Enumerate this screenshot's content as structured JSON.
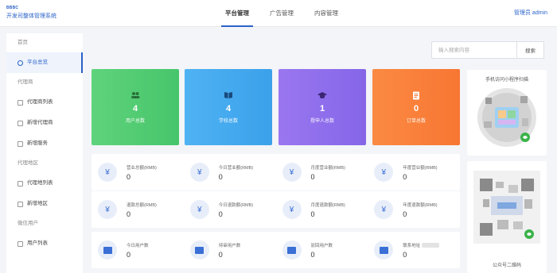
{
  "header": {
    "logo_mark": "BBBC",
    "logo_text": "开发司整体管理系统",
    "nav": [
      {
        "label": "平台管理",
        "active": true
      },
      {
        "label": "广告管理",
        "active": false
      },
      {
        "label": "内容管理",
        "active": false
      }
    ],
    "user": "管理员 admin"
  },
  "sidebar": {
    "items": [
      {
        "type": "group",
        "label": "首页"
      },
      {
        "type": "item",
        "label": "平台总览",
        "active": true
      },
      {
        "type": "group",
        "label": "代理商"
      },
      {
        "type": "item",
        "label": "代理商列表"
      },
      {
        "type": "item",
        "label": "新增代理商"
      },
      {
        "type": "item",
        "label": "新增服务"
      },
      {
        "type": "group",
        "label": "代理地区"
      },
      {
        "type": "item",
        "label": "代理地列表"
      },
      {
        "type": "item",
        "label": "新增地区"
      },
      {
        "type": "group",
        "label": "微信用户"
      },
      {
        "type": "item",
        "label": "用户列表"
      }
    ]
  },
  "search": {
    "placeholder": "输入搜索内容",
    "button": "搜索"
  },
  "cards": [
    {
      "icon": "users-icon",
      "glyph": "👥",
      "value": "4",
      "label": "用户总数",
      "color": "#4fcb72"
    },
    {
      "icon": "book-icon",
      "glyph": "📖",
      "value": "4",
      "label": "学校总数",
      "color": "#42a8ee"
    },
    {
      "icon": "graduation-cap-icon",
      "glyph": "🎓",
      "value": "1",
      "label": "授申人总数",
      "color": "#8e6eec"
    },
    {
      "icon": "document-icon",
      "glyph": "📄",
      "value": "0",
      "label": "订单总数",
      "color": "#f8803a"
    }
  ],
  "stats_row1": [
    {
      "label": "营业总额(RMB)",
      "value": "0"
    },
    {
      "label": "今日营业额(RMB)",
      "value": "0"
    },
    {
      "label": "月度营业额(RMB)",
      "value": "0"
    },
    {
      "label": "年度营业额(RMB)",
      "value": "0"
    }
  ],
  "stats_row2": [
    {
      "label": "退款总额(RMB)",
      "value": "0"
    },
    {
      "label": "今日退款额(RMB)",
      "value": "0"
    },
    {
      "label": "月度退款额(RMB)",
      "value": "0"
    },
    {
      "label": "年度退款额(RMB)",
      "value": "0"
    }
  ],
  "stats_row3": [
    {
      "label": "今日用户数",
      "value": "0"
    },
    {
      "label": "待审用户数",
      "value": "0"
    },
    {
      "label": "驳回用户数",
      "value": "0"
    },
    {
      "label": "联系地址",
      "value": "0"
    }
  ],
  "qr": {
    "panel1_title": "手机访问小程序扫描",
    "panel2_bottom": "公众号二维码"
  }
}
